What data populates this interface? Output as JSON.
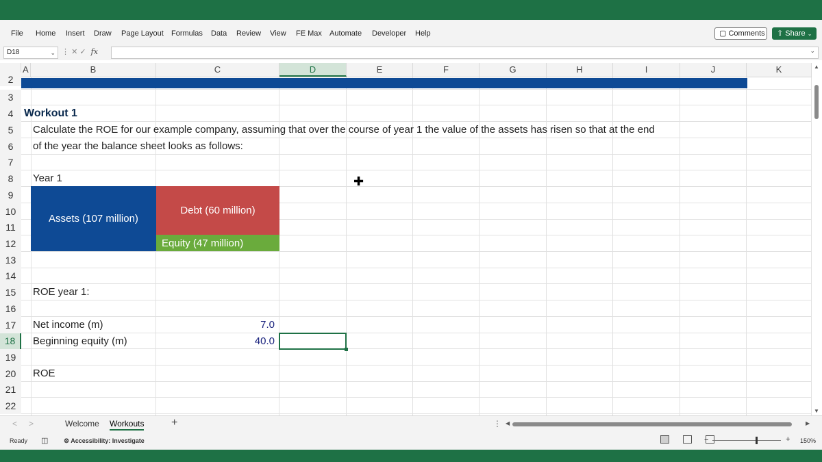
{
  "ribbon": {
    "tabs": [
      "File",
      "Home",
      "Insert",
      "Draw",
      "Page Layout",
      "Formulas",
      "Data",
      "Review",
      "View",
      "FE Max",
      "Automate",
      "Developer",
      "Help"
    ],
    "comments_label": "Comments",
    "share_label": "Share",
    "comments_icon": "comment-icon",
    "share_icon": "share-icon"
  },
  "formula_bar": {
    "name_box": "D18",
    "fx_label": "fx",
    "formula_value": ""
  },
  "columns": [
    "A",
    "B",
    "C",
    "D",
    "E",
    "F",
    "G",
    "H",
    "I",
    "J",
    "K"
  ],
  "selected_column": "D",
  "rows": [
    "2",
    "3",
    "4",
    "5",
    "6",
    "7",
    "8",
    "9",
    "10",
    "11",
    "12",
    "13",
    "14",
    "15",
    "16",
    "17",
    "18",
    "19",
    "20",
    "21",
    "22"
  ],
  "selected_row": "18",
  "sheet": {
    "title": "Workout 1",
    "line1": "Calculate the ROE for our example company, assuming that over the course of year 1 the value of the assets has risen so that at the end",
    "line2": "of the year the balance sheet looks as follows:",
    "year_label": "Year 1",
    "assets": "Assets (107 million)",
    "debt": "Debt (60 million)",
    "equity": "Equity (47 million)",
    "roe_year_label": "ROE year 1:",
    "net_income_label": "Net income (m)",
    "net_income_value": "7.0",
    "beginning_equity_label": "Beginning equity (m)",
    "beginning_equity_value": "40.0",
    "roe_label": "ROE"
  },
  "sheet_tabs": [
    "Welcome",
    "Workouts"
  ],
  "active_tab": "Workouts",
  "status": {
    "ready": "Ready",
    "accessibility": "Accessibility: Investigate",
    "zoom": "150%"
  },
  "colors": {
    "excel_green": "#1e7145",
    "banner_blue": "#0e4a95",
    "debt_red": "#c44a48",
    "equity_green": "#6aab3c"
  }
}
